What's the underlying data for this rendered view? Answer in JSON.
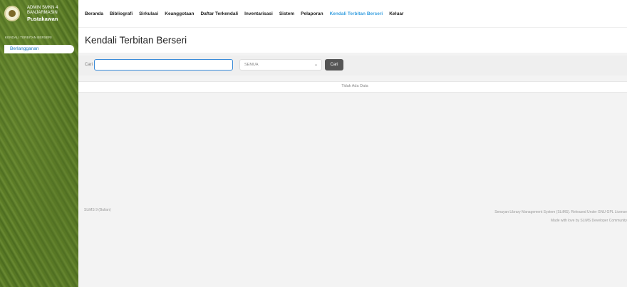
{
  "brand": {
    "line1": "ADMIN SMKN 4",
    "line2": "BANJARMASIN",
    "role": "Pustakawan"
  },
  "sidebar": {
    "section_label": "KENDALI TERBITAN BERSERI",
    "items": [
      {
        "label": "Berlangganan",
        "active": true
      }
    ]
  },
  "nav": {
    "items": [
      {
        "label": "Beranda"
      },
      {
        "label": "Bibliografi"
      },
      {
        "label": "Sirkulasi"
      },
      {
        "label": "Keanggotaan"
      },
      {
        "label": "Daftar Terkendali"
      },
      {
        "label": "Inventarisasi"
      },
      {
        "label": "Sistem"
      },
      {
        "label": "Pelaporan"
      },
      {
        "label": "Kendali Terbitan Berseri",
        "active": true
      },
      {
        "label": "Keluar"
      }
    ]
  },
  "page": {
    "title": "Kendali Terbitan Berseri"
  },
  "search": {
    "label": "Cari",
    "input_value": "",
    "field_selected": "SEMUA",
    "button_label": "Cari"
  },
  "table": {
    "empty_message": "Tidak Ada Data"
  },
  "footer": {
    "version": "SLiMS 9 (Bulian)",
    "credit_line1": "Senayan Library Management System (SLiMS). Released Under GNU GPL License",
    "credit_line2": "Made with love by SLiMS Developer Community"
  },
  "colors": {
    "accent": "#3aa0e0",
    "sidebar_green": "#56761f",
    "button_dark": "#555555",
    "input_border": "#3a8bd8"
  }
}
